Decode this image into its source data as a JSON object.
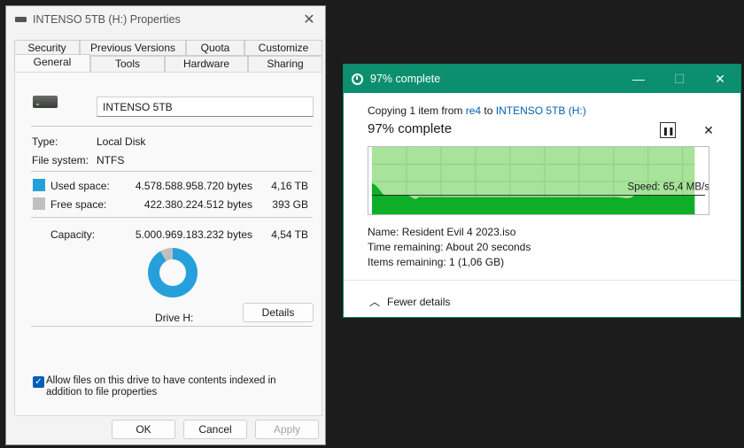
{
  "properties": {
    "title": "INTENSO 5TB (H:) Properties",
    "tabs_top": [
      "Security",
      "Previous Versions",
      "Quota",
      "Customize"
    ],
    "tabs_bottom": [
      "General",
      "Tools",
      "Hardware",
      "Sharing"
    ],
    "active_tab": "General",
    "drive_name": "INTENSO 5TB",
    "type_label": "Type:",
    "type_value": "Local Disk",
    "fs_label": "File system:",
    "fs_value": "NTFS",
    "used_label": "Used space:",
    "used_bytes": "4.578.588.958.720 bytes",
    "used_size": "4,16 TB",
    "free_label": "Free space:",
    "free_bytes": "422.380.224.512 bytes",
    "free_size": "393 GB",
    "capacity_label": "Capacity:",
    "capacity_bytes": "5.000.969.183.232 bytes",
    "capacity_size": "4,54 TB",
    "used_fraction": 0.9155,
    "drive_caption": "Drive H:",
    "details_button": "Details",
    "index_checkbox_label": "Allow files on this drive to have contents indexed in addition to file properties",
    "index_checked": true,
    "ok": "OK",
    "cancel": "Cancel",
    "apply": "Apply",
    "colors": {
      "used": "#26a0da",
      "free": "#bfbfbf"
    }
  },
  "copy": {
    "title": "97% complete",
    "copying_prefix": "Copying 1 item from ",
    "source": "re4",
    "to_word": " to ",
    "destination": "INTENSO 5TB (H:)",
    "heading": "97% complete",
    "progress_fraction": 0.97,
    "speed": "Speed: 65,4 MB/s",
    "name_label": "Name:",
    "name_value": "Resident Evil 4 2023.iso",
    "time_label": "Time remaining:",
    "time_value": "About 20 seconds",
    "items_label": "Items remaining:",
    "items_value": "1 (1,06 GB)",
    "fewer_details": "Fewer details",
    "icons": {
      "pause": "pause-icon",
      "cancel": "close-icon",
      "collapse": "chevron-up-icon"
    },
    "colors": {
      "titlebar": "#0b8f6e",
      "graph_fill": "#a7e39a",
      "graph_speed": "#0fae28"
    }
  }
}
